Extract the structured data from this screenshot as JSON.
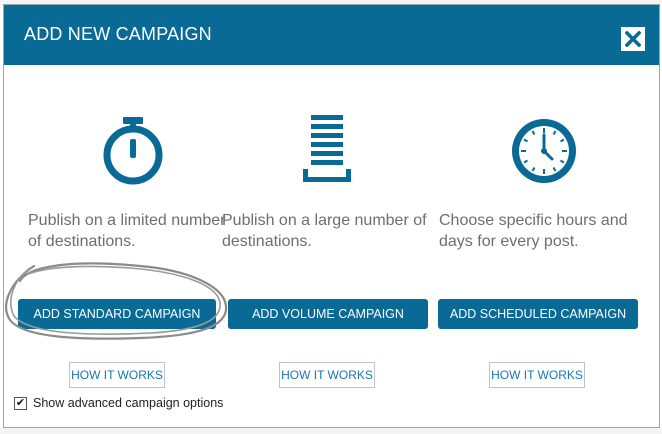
{
  "dialog": {
    "title": "ADD NEW CAMPAIGN",
    "close_icon": "close-icon"
  },
  "options": [
    {
      "icon": "stopwatch-icon",
      "description": "Publish on a limited number of destinations.",
      "button_label": "ADD STANDARD CAMPAIGN",
      "link_label": "HOW IT WORKS"
    },
    {
      "icon": "list-stack-icon",
      "description": "Publish on a large number of destinations.",
      "button_label": "ADD VOLUME CAMPAIGN",
      "link_label": "HOW IT WORKS"
    },
    {
      "icon": "clock-icon",
      "description": "Choose specific hours and days for every post.",
      "button_label": "ADD SCHEDULED CAMPAIGN",
      "link_label": "HOW IT WORKS"
    }
  ],
  "advanced": {
    "label": "Show advanced campaign options",
    "checked": true
  },
  "colors": {
    "header": "#0a6a96",
    "button": "#0a6a96",
    "link": "#1976b7",
    "description": "#6e6e6e"
  }
}
